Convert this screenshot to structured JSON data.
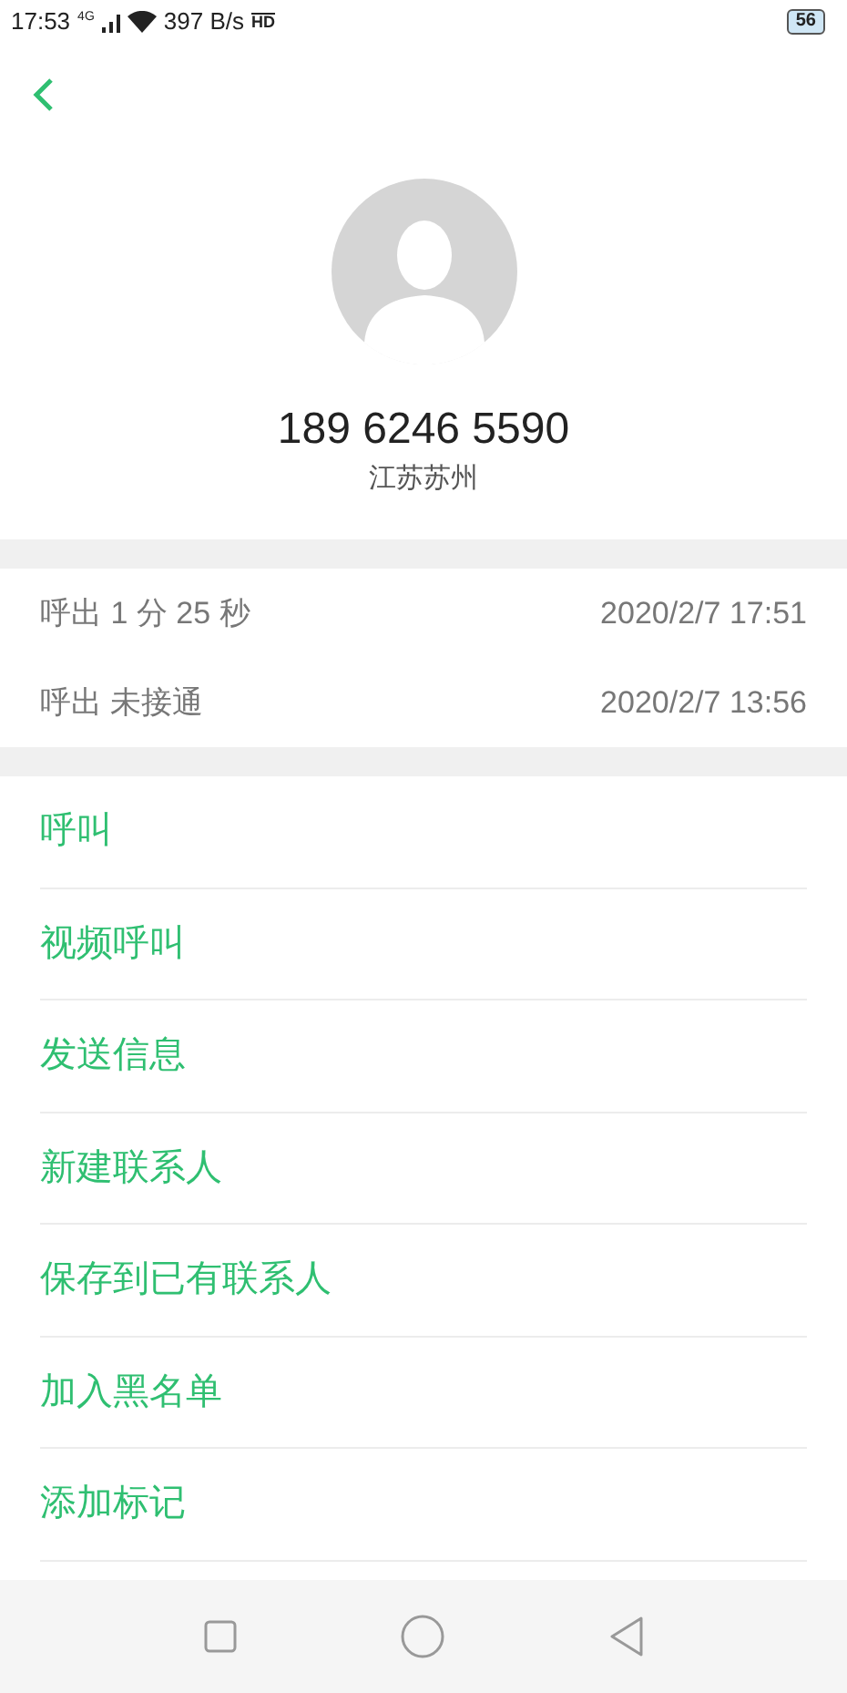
{
  "status_bar": {
    "time": "17:53",
    "network": "4G",
    "speed": "397 B/s",
    "hd": "HD",
    "battery": "56"
  },
  "contact": {
    "number": "189 6246 5590",
    "location": "江苏苏州"
  },
  "call_log": [
    {
      "type": "呼出",
      "detail": "1 分 25 秒",
      "time": "2020/2/7 17:51"
    },
    {
      "type": "呼出",
      "detail": "未接通",
      "time": "2020/2/7 13:56"
    }
  ],
  "actions": [
    "呼叫",
    "视频呼叫",
    "发送信息",
    "新建联系人",
    "保存到已有联系人",
    "加入黑名单",
    "添加标记"
  ]
}
